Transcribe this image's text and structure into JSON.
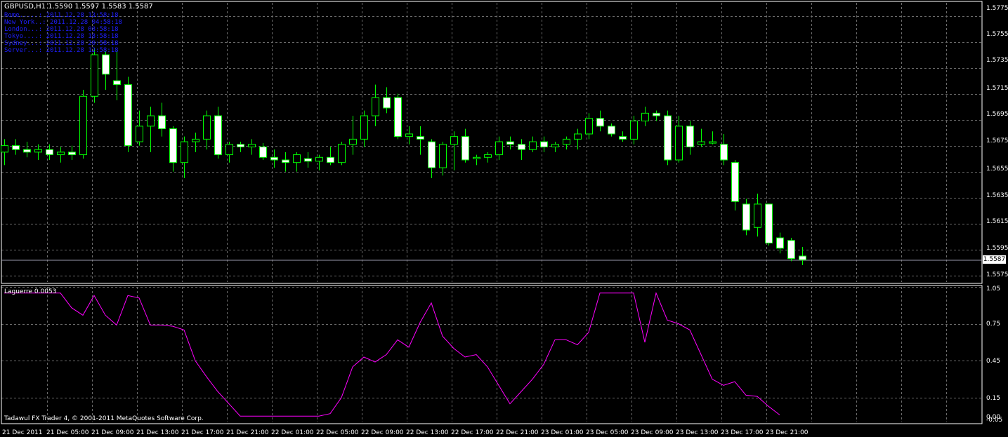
{
  "header": {
    "symbol_line": "GBPUSD,H1  1.5590 1.5597 1.5583 1.5587",
    "clocks": [
      "Rome.....: 2011.12.28 13:58:18",
      "New York..: 2011.12.28 04:58:18",
      "London...: 2011.12.28 08:58:18",
      "Tokyo....: 2011.12.28 18:58:18",
      "Sydney...: 2011.12.28 20:58:18",
      "Server...: 2011.12.28 12:58:18"
    ]
  },
  "price_axis": {
    "ticks": [
      "1.5775",
      "1.5755",
      "1.5735",
      "1.5715",
      "1.5695",
      "1.5675",
      "1.5655",
      "1.5635",
      "1.5615",
      "1.5595",
      "1.5575"
    ],
    "current_price": "1.5587"
  },
  "indicator": {
    "title": "Laguerre 0.0053",
    "ticks": [
      "1.05",
      "0.75",
      "0.45",
      "0.15",
      "0.00",
      "-0.05"
    ],
    "line_color": "#ff00ff",
    "values": [
      1.0,
      1.0,
      1.0,
      1.0,
      1.0,
      1.0,
      0.88,
      0.82,
      0.98,
      0.82,
      0.74,
      0.98,
      0.96,
      0.74,
      0.74,
      0.73,
      0.7,
      0.45,
      0.32,
      0.2,
      0.1,
      0.0,
      0.0,
      0.0,
      0.0,
      0.0,
      0.0,
      0.0,
      0.0,
      0.02,
      0.15,
      0.4,
      0.48,
      0.44,
      0.5,
      0.62,
      0.56,
      0.76,
      0.92,
      0.65,
      0.55,
      0.48,
      0.5,
      0.4,
      0.25,
      0.1,
      0.2,
      0.3,
      0.42,
      0.62,
      0.62,
      0.58,
      0.68,
      1.0,
      1.0,
      1.0,
      1.0,
      0.6,
      1.0,
      0.78,
      0.75,
      0.7,
      0.5,
      0.3,
      0.25,
      0.28,
      0.17,
      0.16,
      0.08,
      0.01
    ]
  },
  "time_axis": {
    "labels": [
      "21 Dec 2011",
      "21 Dec 05:00",
      "21 Dec 09:00",
      "21 Dec 13:00",
      "21 Dec 17:00",
      "21 Dec 21:00",
      "22 Dec 01:00",
      "22 Dec 05:00",
      "22 Dec 09:00",
      "22 Dec 13:00",
      "22 Dec 17:00",
      "22 Dec 21:00",
      "23 Dec 01:00",
      "23 Dec 05:00",
      "23 Dec 09:00",
      "23 Dec 13:00",
      "23 Dec 17:00",
      "23 Dec 21:00"
    ]
  },
  "footer": {
    "copyright": "Tadawul FX Trader 4, © 2001-2011 MetaQuotes Software Corp."
  },
  "colors": {
    "bull_candle": "#000000",
    "bear_candle": "#ffffff",
    "wick": "#00ff00",
    "grid": "#6a6a6a"
  },
  "chart_data": {
    "type": "candlestick",
    "x_label_step_bars": 4,
    "candles": [
      [
        1.567,
        1.568,
        1.566,
        1.5675
      ],
      [
        1.5675,
        1.568,
        1.5668,
        1.5672
      ],
      [
        1.5672,
        1.5678,
        1.5666,
        1.567
      ],
      [
        1.567,
        1.5676,
        1.5664,
        1.5672
      ],
      [
        1.5672,
        1.5676,
        1.5664,
        1.5668
      ],
      [
        1.5668,
        1.5674,
        1.5662,
        1.567
      ],
      [
        1.567,
        1.5675,
        1.5664,
        1.5668
      ],
      [
        1.5668,
        1.5718,
        1.5665,
        1.5713
      ],
      [
        1.5713,
        1.575,
        1.5708,
        1.5745
      ],
      [
        1.5745,
        1.5748,
        1.5718,
        1.573
      ],
      [
        1.5725,
        1.5748,
        1.571,
        1.5722
      ],
      [
        1.5722,
        1.5728,
        1.567,
        1.5675
      ],
      [
        1.5678,
        1.5702,
        1.5675,
        1.569
      ],
      [
        1.569,
        1.5705,
        1.567,
        1.5698
      ],
      [
        1.5698,
        1.5708,
        1.5682,
        1.5688
      ],
      [
        1.5688,
        1.569,
        1.5655,
        1.5662
      ],
      [
        1.5662,
        1.5682,
        1.565,
        1.5678
      ],
      [
        1.5678,
        1.5685,
        1.567,
        1.568
      ],
      [
        1.568,
        1.5702,
        1.5672,
        1.5698
      ],
      [
        1.5698,
        1.5705,
        1.5665,
        1.5668
      ],
      [
        1.5668,
        1.5678,
        1.5662,
        1.5676
      ],
      [
        1.5676,
        1.5678,
        1.567,
        1.5674
      ],
      [
        1.5674,
        1.568,
        1.5668,
        1.5676
      ],
      [
        1.5674,
        1.5677,
        1.5664,
        1.5666
      ],
      [
        1.5666,
        1.5672,
        1.5658,
        1.5664
      ],
      [
        1.5664,
        1.567,
        1.5655,
        1.5662
      ],
      [
        1.5662,
        1.567,
        1.5655,
        1.5668
      ],
      [
        1.5665,
        1.567,
        1.5658,
        1.5663
      ],
      [
        1.5663,
        1.5668,
        1.5656,
        1.5666
      ],
      [
        1.5666,
        1.5674,
        1.566,
        1.5662
      ],
      [
        1.5662,
        1.5678,
        1.566,
        1.5676
      ],
      [
        1.5676,
        1.5698,
        1.5668,
        1.568
      ],
      [
        1.568,
        1.5702,
        1.5674,
        1.5698
      ],
      [
        1.5698,
        1.5722,
        1.569,
        1.5712
      ],
      [
        1.5712,
        1.572,
        1.57,
        1.5704
      ],
      [
        1.5712,
        1.5715,
        1.568,
        1.5682
      ],
      [
        1.5682,
        1.569,
        1.5676,
        1.5684
      ],
      [
        1.5682,
        1.569,
        1.5668,
        1.568
      ],
      [
        1.5678,
        1.568,
        1.565,
        1.5658
      ],
      [
        1.5658,
        1.5678,
        1.5652,
        1.5676
      ],
      [
        1.5676,
        1.5686,
        1.5656,
        1.5682
      ],
      [
        1.5682,
        1.5688,
        1.5662,
        1.5664
      ],
      [
        1.5666,
        1.5668,
        1.566,
        1.5666
      ],
      [
        1.5666,
        1.567,
        1.5662,
        1.5668
      ],
      [
        1.5668,
        1.5682,
        1.5664,
        1.5678
      ],
      [
        1.5678,
        1.5682,
        1.5672,
        1.5676
      ],
      [
        1.5676,
        1.568,
        1.5664,
        1.5672
      ],
      [
        1.5672,
        1.5682,
        1.567,
        1.5678
      ],
      [
        1.5678,
        1.5682,
        1.567,
        1.5674
      ],
      [
        1.5674,
        1.5678,
        1.567,
        1.5676
      ],
      [
        1.5676,
        1.5682,
        1.5672,
        1.568
      ],
      [
        1.568,
        1.5688,
        1.5672,
        1.5684
      ],
      [
        1.5684,
        1.57,
        1.568,
        1.5696
      ],
      [
        1.5696,
        1.5702,
        1.5686,
        1.569
      ],
      [
        1.569,
        1.5692,
        1.5682,
        1.5684
      ],
      [
        1.5682,
        1.5686,
        1.5678,
        1.568
      ],
      [
        1.568,
        1.5698,
        1.5676,
        1.5694
      ],
      [
        1.5694,
        1.5705,
        1.569,
        1.57
      ],
      [
        1.57,
        1.5702,
        1.5694,
        1.5698
      ],
      [
        1.5698,
        1.5702,
        1.566,
        1.5664
      ],
      [
        1.5664,
        1.5698,
        1.5662,
        1.569
      ],
      [
        1.569,
        1.5694,
        1.5668,
        1.5674
      ],
      [
        1.5676,
        1.5688,
        1.5674,
        1.5678
      ],
      [
        1.5678,
        1.5686,
        1.5676,
        1.5678
      ],
      [
        1.5676,
        1.5684,
        1.566,
        1.5664
      ],
      [
        1.5662,
        1.5664,
        1.5625,
        1.5632
      ],
      [
        1.563,
        1.5634,
        1.5606,
        1.561
      ],
      [
        1.5612,
        1.5638,
        1.5605,
        1.563
      ],
      [
        1.563,
        1.563,
        1.5598,
        1.56
      ],
      [
        1.5604,
        1.5608,
        1.5592,
        1.5596
      ],
      [
        1.5602,
        1.5604,
        1.5586,
        1.5588
      ],
      [
        1.559,
        1.5597,
        1.5583,
        1.5587
      ]
    ],
    "price_range": [
      1.557,
      1.5785
    ],
    "indicator_range": [
      -0.05,
      1.05
    ]
  }
}
